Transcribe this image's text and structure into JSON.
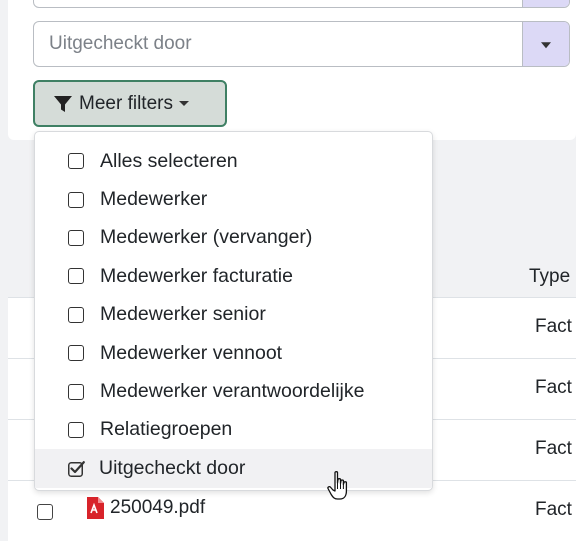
{
  "filters": {
    "checked_out_by_placeholder": "Uitgecheckt door",
    "more_filters_label": "Meer filters"
  },
  "dropdown": {
    "items": [
      {
        "label": "Alles selecteren",
        "checked": false
      },
      {
        "label": "Medewerker",
        "checked": false
      },
      {
        "label": "Medewerker (vervanger)",
        "checked": false
      },
      {
        "label": "Medewerker facturatie",
        "checked": false
      },
      {
        "label": "Medewerker senior",
        "checked": false
      },
      {
        "label": "Medewerker vennoot",
        "checked": false
      },
      {
        "label": "Medewerker verantwoordelijke",
        "checked": false
      },
      {
        "label": "Relatiegroepen",
        "checked": false
      },
      {
        "label": "Uitgecheckt door",
        "checked": true
      }
    ]
  },
  "table": {
    "type_header": "Type",
    "rows": [
      {
        "type": "Fact"
      },
      {
        "type": "Fact"
      },
      {
        "type": "Fact"
      },
      {
        "type": "Fact",
        "file": "250049.pdf"
      }
    ]
  },
  "colors": {
    "accent_button_border": "#3f8064",
    "caret_button_bg": "#dcd9f6",
    "pdf_red": "#d8232a"
  }
}
